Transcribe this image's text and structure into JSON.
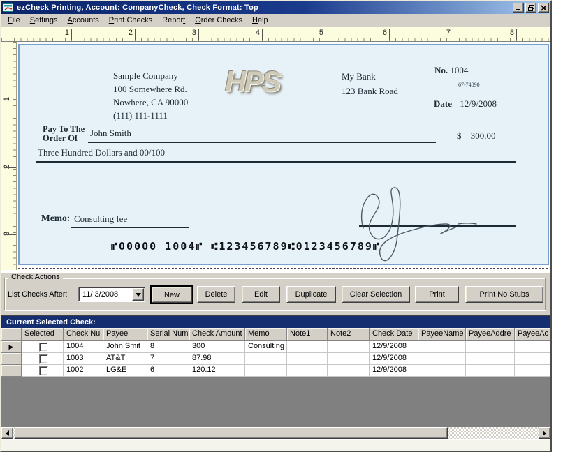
{
  "window": {
    "title": "ezCheck Printing, Account: CompanyCheck, Check Format: Top"
  },
  "menu": {
    "items": [
      {
        "label": "File",
        "accel": 0
      },
      {
        "label": "Settings",
        "accel": 0
      },
      {
        "label": "Accounts",
        "accel": 0
      },
      {
        "label": "Print Checks",
        "accel": 0
      },
      {
        "label": "Report",
        "accel": 5
      },
      {
        "label": "Order Checks",
        "accel": 0
      },
      {
        "label": "Help",
        "accel": 0
      }
    ]
  },
  "ruler": {
    "h_numbers": [
      "1",
      "2",
      "3",
      "4",
      "5",
      "6",
      "7",
      "8"
    ],
    "v_numbers": [
      "1",
      "2",
      "3"
    ]
  },
  "check": {
    "company_lines": [
      "Sample Company",
      "100 Somewhere Rd.",
      "Nowhere, CA 90000",
      "(111) 111-1111"
    ],
    "logo": "HPS",
    "bank_lines": [
      "My Bank",
      "123 Bank Road"
    ],
    "no_label": "No.",
    "no_value": "1004",
    "fraction": "67-74890",
    "date_label": "Date",
    "date_value": "12/9/2008",
    "pay_line1": "Pay To The",
    "pay_line2": "Order Of",
    "payee": "John Smith",
    "dollar": "$",
    "amount": "300.00",
    "amount_words": "Three Hundred  Dollars and 00/100",
    "memo_label": "Memo:",
    "memo_value": "Consulting fee",
    "micr": "⑈00000 1004⑈ ⑆123456789⑆0123456789⑈"
  },
  "actions": {
    "group_label": "Check Actions",
    "list_label": "List Checks After:",
    "date_value": "11/ 3/2008",
    "buttons": [
      "New",
      "Delete",
      "Edit",
      "Duplicate",
      "Clear Selection",
      "Print",
      "Print No Stubs"
    ]
  },
  "selected_bar": {
    "title": "Current Selected Check:"
  },
  "grid": {
    "columns": [
      "Selected",
      "Check Nu",
      "Payee",
      "Serial Num",
      "Check Amount",
      "Memo",
      "Note1",
      "Note2",
      "Check Date",
      "PayeeName",
      "PayeeAddre",
      "PayeeAc"
    ],
    "rows": [
      {
        "selected": false,
        "current": true,
        "cells": [
          "1004",
          "John Smit",
          "8",
          "300",
          "Consulting",
          "",
          "",
          "12/9/2008",
          "",
          "",
          ""
        ]
      },
      {
        "selected": false,
        "current": false,
        "cells": [
          "1003",
          "AT&T",
          "7",
          "87.98",
          "",
          "",
          "",
          "12/9/2008",
          "",
          "",
          ""
        ]
      },
      {
        "selected": false,
        "current": false,
        "cells": [
          "1002",
          "LG&E",
          "6",
          "120.12",
          "",
          "",
          "",
          "12/9/2008",
          "",
          "",
          ""
        ]
      }
    ]
  }
}
